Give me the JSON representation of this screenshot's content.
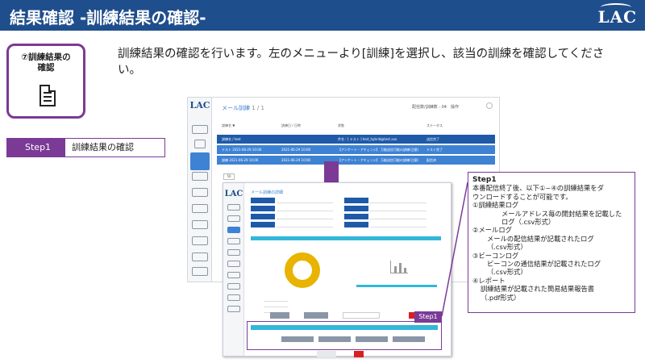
{
  "header": {
    "title": "結果確認 -訓練結果の確認-",
    "logo": "LAC"
  },
  "card": {
    "label_line1": "⑦訓練結果の",
    "label_line2": "確認"
  },
  "intro": {
    "text": "訓練結果の確認を行います。左のメニューより[訓練]を選択し、該当の訓練を確認してください。"
  },
  "step": {
    "badge": "Step1",
    "text": "訓練結果の確認"
  },
  "screen1": {
    "logo": "LAC",
    "title": "メール訓練",
    "count": "1 / 1",
    "pager": "配信数/訓練数 : 04",
    "filter": "操作",
    "select": "50",
    "columns": [
      "訓練名 ▼",
      "訓練日 / 日時",
      "状態",
      "ステータス"
    ],
    "rows": [
      {
        "name": "訓練名 / test",
        "date": "",
        "subject": "件名 : [ テスト ] test_hybrid@test.xxx",
        "status": "送信完了"
      },
      {
        "name": "テスト  2021-06-29 10:00",
        "date": "2021-06-29 10:00",
        "subject": "【アンケート・アチェンジ】  万能送信可能の訓練(注意)",
        "status": "テスト完了"
      },
      {
        "name": "訓練  2021-06-29 10:00",
        "date": "2021-06-29 10:00",
        "subject": "【アンケート・アチェンジ】  万能送信可能の訓練(注意)",
        "status": "配信済"
      }
    ]
  },
  "screen2": {
    "logo": "LAC",
    "title": "メール訓練の詳細",
    "step_tag": "Step1"
  },
  "callout": {
    "title": "Step1",
    "intro_line1": "本番配信終了後、以下①~④の訓練結果をダ",
    "intro_line2": "ウンロードすることが可能です。",
    "item1": "①訓練結果ログ",
    "item1_desc_line1": "メールアドレス毎の開封結果を記載した",
    "item1_desc_line2": "ログ（.csv形式）",
    "item2": "②メールログ",
    "item2_desc_line1": "メールの配信結果が記載されたログ",
    "item2_desc_line2": "（.csv形式）",
    "item3": "③ビーコンログ",
    "item3_desc_line1": "ビーコンの通信結果が記載されたログ",
    "item3_desc_line2": "（.csv形式）",
    "item4": "④レポート",
    "item4_desc_line1": "訓練結果が記載された簡易結果報告書",
    "item4_desc_line2": "（.pdf形式）"
  },
  "colors": {
    "header_bg": "#1f4e8c",
    "accent_purple": "#7b3a96",
    "row_blue": "#3e82d4",
    "teal": "#32b7d9",
    "donut": "#e8b400",
    "danger": "#d92020"
  }
}
